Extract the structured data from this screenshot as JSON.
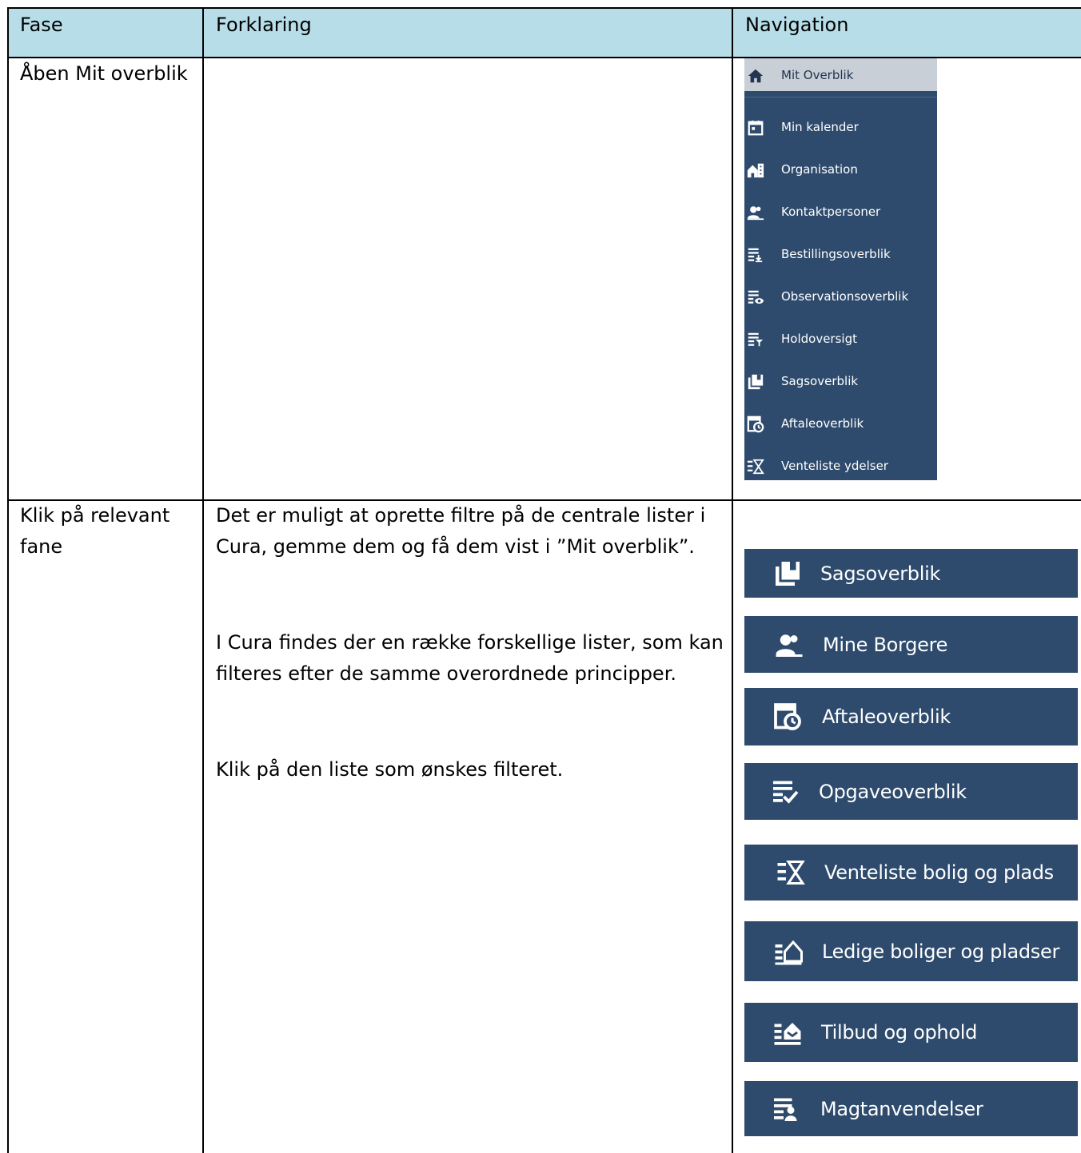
{
  "table": {
    "headers": [
      "Fase",
      "Forklaring",
      "Navigation"
    ],
    "rows": [
      {
        "fase": "Åben Mit overblik",
        "forklaring": []
      },
      {
        "fase_lines": [
          "Klik på relevant",
          "fane"
        ],
        "forklaring_lines": [
          "Det er muligt at oprette filtre på de centrale lister i",
          "Cura, gemme dem og få dem vist i ”Mit overblik”.",
          "I Cura findes der en række forskellige lister, som kan",
          "filteres efter de samme overordnede principper.",
          "Klik på den liste som ønskes filteret."
        ]
      }
    ]
  },
  "sidebar": {
    "items": [
      {
        "label": "Mit Overblik",
        "icon": "home-icon",
        "active": true
      },
      {
        "label": "Min kalender",
        "icon": "calendar-icon"
      },
      {
        "label": "Organisation",
        "icon": "organisation-icon"
      },
      {
        "label": "Kontaktpersoner",
        "icon": "contacts-icon"
      },
      {
        "label": "Bestillingsoverblik",
        "icon": "order-list-icon"
      },
      {
        "label": "Observationsoverblik",
        "icon": "observation-list-icon"
      },
      {
        "label": "Holdoversigt",
        "icon": "team-list-icon"
      },
      {
        "label": "Sagsoverblik",
        "icon": "cases-icon"
      },
      {
        "label": "Aftaleoverblik",
        "icon": "appointments-icon"
      },
      {
        "label": "Venteliste ydelser",
        "icon": "waitlist-icon"
      }
    ]
  },
  "buttons": [
    {
      "label": "Sagsoverblik",
      "icon": "cases-icon"
    },
    {
      "label": "Mine Borgere",
      "icon": "citizens-icon"
    },
    {
      "label": "Aftaleoverblik",
      "icon": "appointments-icon"
    },
    {
      "label": "Opgaveoverblik",
      "icon": "task-list-icon"
    },
    {
      "label": "Venteliste bolig og plads",
      "icon": "waitlist-icon"
    },
    {
      "label": "Ledige boliger og pladser",
      "icon": "vacant-housing-icon"
    },
    {
      "label": "Tilbud og ophold",
      "icon": "offers-icon"
    },
    {
      "label": "Magtanvendelser",
      "icon": "coercion-icon"
    }
  ],
  "colors": {
    "header_bg": "#b7dde8",
    "nav_bg": "#2e4b6d",
    "nav_active_bg": "#c9cfd6"
  }
}
